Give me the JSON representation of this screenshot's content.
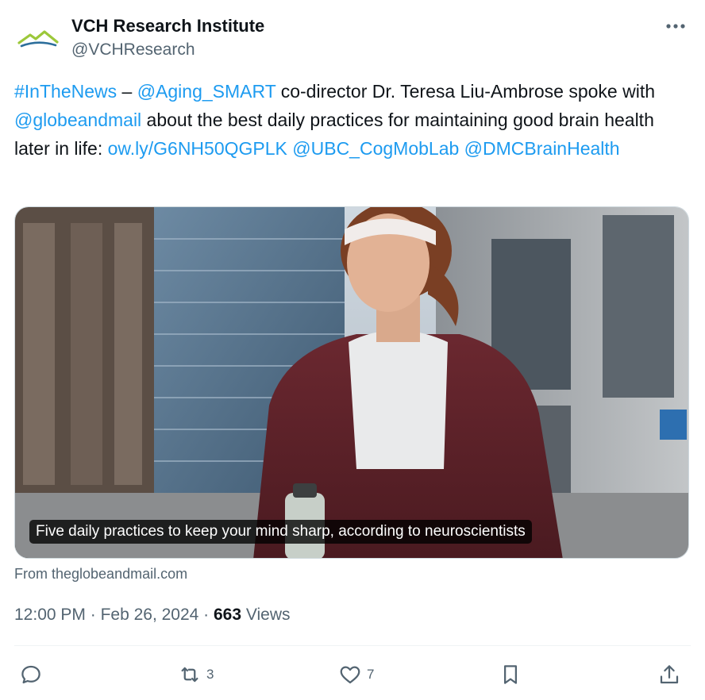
{
  "account": {
    "display_name": "VCH Research Institute",
    "handle": "@VCHResearch"
  },
  "tweet": {
    "segments": [
      {
        "text": "#InTheNews",
        "link": true
      },
      {
        "text": " – ",
        "link": false
      },
      {
        "text": "@Aging_SMART",
        "link": true
      },
      {
        "text": " co-director Dr. Teresa Liu-Ambrose spoke with ",
        "link": false
      },
      {
        "text": "@globeandmail",
        "link": true
      },
      {
        "text": " about the best daily practices for maintaining good brain health later in life: ",
        "link": false
      },
      {
        "text": "ow.ly/G6NH50QGPLK",
        "link": true
      },
      {
        "text": " ",
        "link": false
      },
      {
        "text": "@UBC_CogMobLab",
        "link": true
      },
      {
        "text": " ",
        "link": false
      },
      {
        "text": "@DMCBrainHealth",
        "link": true
      }
    ]
  },
  "media": {
    "caption": "Five daily practices to keep your mind sharp, according to neuroscientists"
  },
  "source": "From theglobeandmail.com",
  "meta": {
    "time": "12:00 PM",
    "separator": "·",
    "date": "Feb 26, 2024",
    "views_count": "663",
    "views_label": "Views"
  },
  "actions": {
    "retweets": "3",
    "likes": "7"
  },
  "colors": {
    "link": "#1d9bf0",
    "secondary_text": "#536471",
    "primary_text": "#0f1419"
  },
  "icons": {
    "avatar": "vch-mountain-logo",
    "more": "more-horizontal-icon",
    "reply": "reply-icon",
    "retweet": "retweet-icon",
    "like": "heart-icon",
    "bookmark": "bookmark-icon",
    "share": "share-icon"
  }
}
